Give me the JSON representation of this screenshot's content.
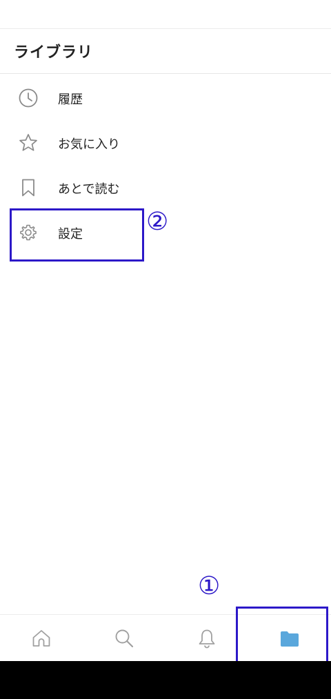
{
  "header": {
    "title": "ライブラリ"
  },
  "menu": {
    "items": [
      {
        "label": "履歴",
        "icon": "clock-icon"
      },
      {
        "label": "お気に入り",
        "icon": "star-icon"
      },
      {
        "label": "あとで読む",
        "icon": "bookmark-icon"
      },
      {
        "label": "設定",
        "icon": "gear-icon"
      }
    ]
  },
  "annotations": {
    "settings_marker": "②",
    "library_tab_marker": "①",
    "color": "#2c18c8"
  },
  "tabbar": {
    "tabs": [
      {
        "icon": "home-icon"
      },
      {
        "icon": "search-icon"
      },
      {
        "icon": "bell-icon"
      },
      {
        "icon": "folder-icon",
        "active": true
      }
    ],
    "active_color": "#5aa7dc",
    "inactive_color": "#a0a0a0"
  }
}
